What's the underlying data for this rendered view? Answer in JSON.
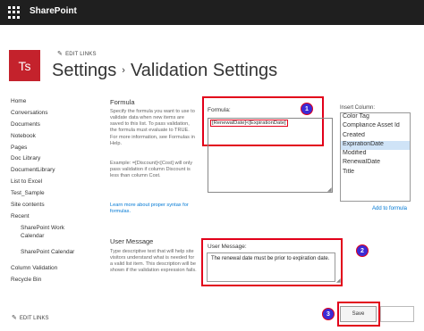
{
  "suitebar": {
    "brand": "SharePoint"
  },
  "site": {
    "logo_text": "Ts",
    "edit_links": "EDIT LINKS"
  },
  "header": {
    "crumb": "Settings",
    "separator": "›",
    "page": "Validation Settings"
  },
  "nav": {
    "items": [
      {
        "label": "Home",
        "indent": false
      },
      {
        "label": "Conversations",
        "indent": false
      },
      {
        "label": "Documents",
        "indent": false
      },
      {
        "label": "Notebook",
        "indent": false
      },
      {
        "label": "Pages",
        "indent": false
      },
      {
        "label": "Doc Library",
        "indent": false
      },
      {
        "label": "DocumentLibrary",
        "indent": false
      },
      {
        "label": "List to Excel",
        "indent": false
      },
      {
        "label": "Test_Sample",
        "indent": false
      },
      {
        "label": "Site contents",
        "indent": false
      },
      {
        "label": "Recent",
        "indent": false
      },
      {
        "label": "SharePoint Work",
        "indent": true
      },
      {
        "label": "Calendar",
        "indent": true
      },
      {
        "label": "SharePoint Calendar",
        "indent": true
      },
      {
        "label": "Column Validation",
        "indent": false
      },
      {
        "label": "Recycle Bin",
        "indent": false
      }
    ],
    "edit_links": "EDIT LINKS"
  },
  "formula_section": {
    "title": "Formula",
    "desc1": "Specify the formula you want to use to validate data when new items are saved to this list. To pass validation, the formula must evaluate to TRUE. For more information, see Formulas in Help.",
    "desc2": "Example: =[Discount]<[Cost] will only pass validation if column Discount is less than column Cost.",
    "link": "Learn more about proper syntax for formulas.",
    "field_label": "Formula:",
    "value_col1": "[RenewalDate]",
    "value_op": "<",
    "value_col2": "[ExpirationDate]",
    "callout": "1"
  },
  "insert_column": {
    "label": "Insert Column:",
    "items": [
      "Color Tag",
      "Compliance Asset Id",
      "Created",
      "ExpirationDate",
      "Modified",
      "RenewalDate",
      "Title"
    ],
    "selected": "ExpirationDate",
    "add_link": "Add to formula"
  },
  "message_section": {
    "title": "User Message",
    "desc": "Type descriptive text that will help site visitors understand what is needed for a valid list item. This description will be shown if the validation expression fails.",
    "field_label": "User Message:",
    "value": "The renewal date must be prior to expiration date.",
    "callout": "2"
  },
  "footer": {
    "save_label": "Save",
    "callout": "3"
  },
  "colors": {
    "highlight": "#e2001a",
    "callout_fill": "#3b2bd5",
    "logo": "#c4222c",
    "suitebar": "#1f1f1f",
    "link": "#0078d4"
  }
}
